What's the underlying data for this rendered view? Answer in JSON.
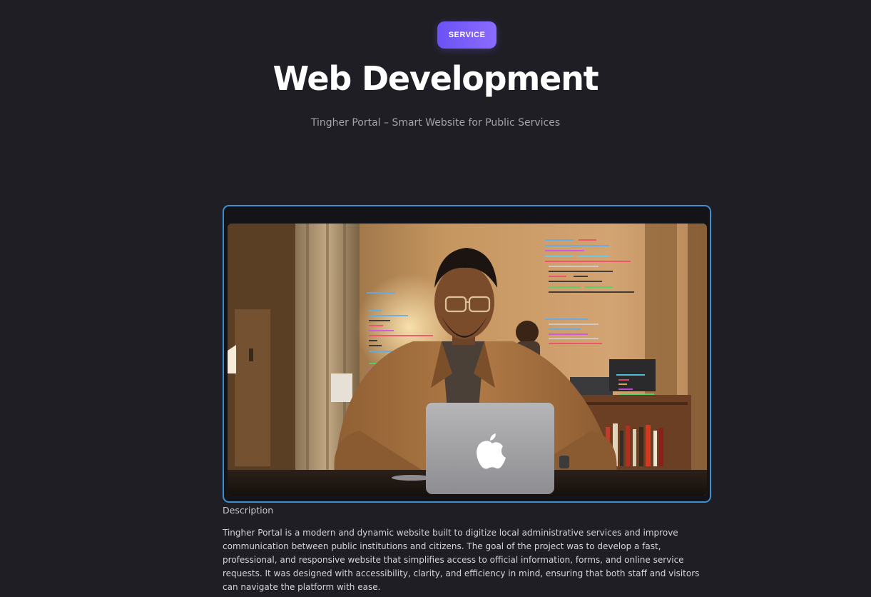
{
  "header": {
    "badge": "SERVICE",
    "title": "Web Development",
    "subtitle": "Tingher Portal – Smart Website for Public Services"
  },
  "media": {
    "icon": "apple-logo-icon",
    "accent_border": "#3d8fd0"
  },
  "description": {
    "heading": "Description",
    "body": "Tingher Portal is a modern and dynamic website built to digitize local administrative services and improve communication between public institutions and citizens. The goal of the project was to develop a fast, professional, and responsive website that simplifies access to official information, forms, and online service requests. It was designed with accessibility, clarity, and efficiency in mind, ensuring that both staff and visitors can navigate the platform with ease."
  },
  "colors": {
    "background": "#1f1e24",
    "badge_gradient_start": "#6b52f5",
    "badge_gradient_end": "#8b6cff",
    "subtitle_text": "#a4a3ab"
  }
}
